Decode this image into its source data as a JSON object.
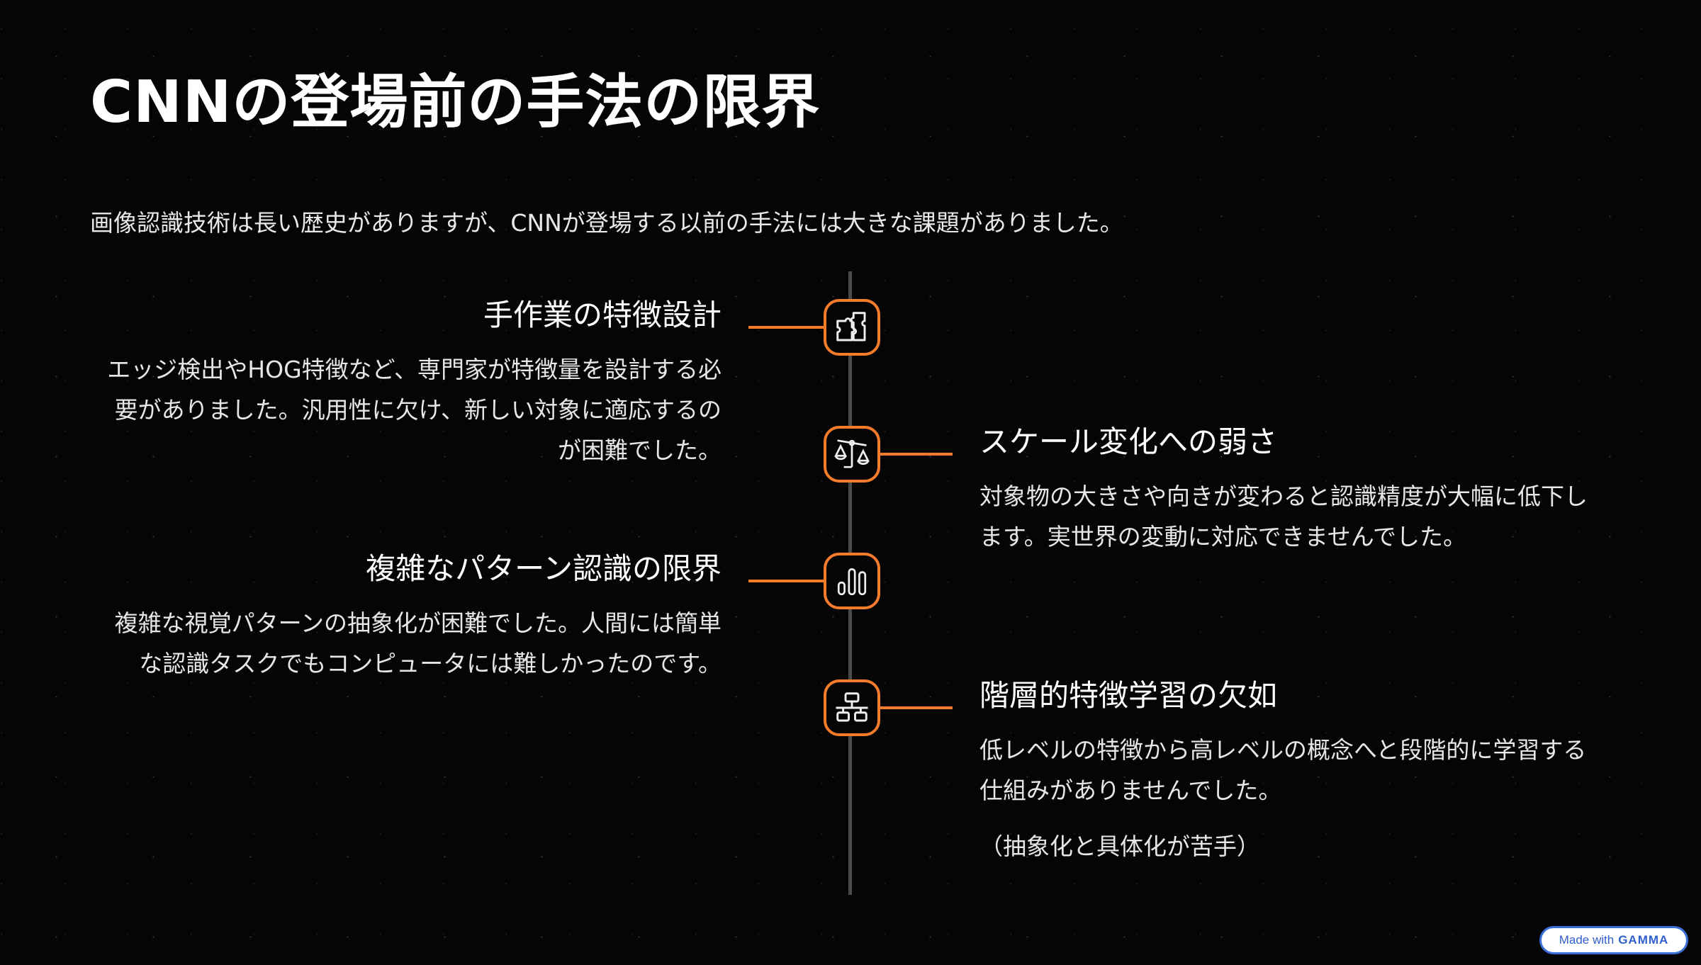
{
  "title": "CNNの登場前の手法の限界",
  "subtitle": "画像認識技術は長い歴史がありますが、CNNが登場する以前の手法には大きな課題がありました。",
  "accent_color": "#f57c2a",
  "items": [
    {
      "icon": "puzzle-icon",
      "heading": "手作業の特徴設計",
      "body": "エッジ検出やHOG特徴など、専門家が特徴量を設計する必要がありました。汎用性に欠け、新しい対象に適応するのが困難でした。"
    },
    {
      "icon": "scale-icon",
      "heading": "スケール変化への弱さ",
      "body": "対象物の大きさや向きが変わると認識精度が大幅に低下します。実世界の変動に対応できませんでした。"
    },
    {
      "icon": "bar-chart-icon",
      "heading": "複雑なパターン認識の限界",
      "body": "複雑な視覚パターンの抽象化が困難でした。人間には簡単な認識タスクでもコンピュータには難しかったのです。"
    },
    {
      "icon": "hierarchy-icon",
      "heading": "階層的特徴学習の欠如",
      "body": "低レベルの特徴から高レベルの概念へと段階的に学習する仕組みがありませんでした。",
      "extra": "（抽象化と具体化が苦手）"
    }
  ],
  "badge": {
    "prefix": "Made with",
    "brand": "GAMMA"
  }
}
